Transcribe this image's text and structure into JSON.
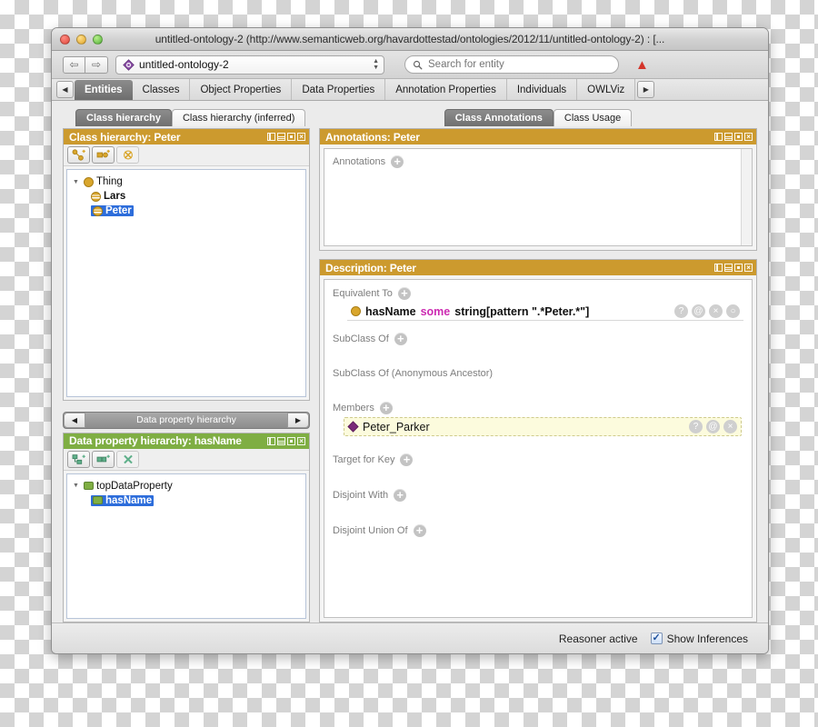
{
  "window": {
    "title": "untitled-ontology-2 (http://www.semanticweb.org/havardottestad/ontologies/2012/11/untitled-ontology-2)  : [...",
    "traffic": {
      "close": "close-button",
      "minimize": "minimize-button",
      "zoom": "zoom-button"
    }
  },
  "toolbar": {
    "back_icon": "⇦",
    "forward_icon": "⇨",
    "ontology_label": "untitled-ontology-2",
    "search_placeholder": "Search for entity",
    "search_value": "",
    "warning_icon": "⚠"
  },
  "main_tabs": {
    "prev_arrow": "◀",
    "next_arrow": "▶",
    "items": [
      {
        "label": "Entities",
        "active": true
      },
      {
        "label": "Classes",
        "active": false
      },
      {
        "label": "Object Properties",
        "active": false
      },
      {
        "label": "Data Properties",
        "active": false
      },
      {
        "label": "Annotation Properties",
        "active": false
      },
      {
        "label": "Individuals",
        "active": false
      },
      {
        "label": "OWLViz",
        "active": false
      }
    ]
  },
  "class_hierarchy": {
    "tabs": [
      {
        "label": "Class hierarchy",
        "active": true
      },
      {
        "label": "Class hierarchy (inferred)",
        "active": false
      }
    ],
    "header": "Class hierarchy: Peter",
    "buttons": [
      {
        "name": "add-subclass-button"
      },
      {
        "name": "add-sibling-class-button"
      },
      {
        "name": "delete-class-button"
      }
    ],
    "tree": [
      {
        "label": "Thing",
        "indent": 0,
        "expander": "▼",
        "selected": false,
        "icon": "class-icon"
      },
      {
        "label": "Lars",
        "indent": 1,
        "expander": "",
        "selected": false,
        "icon": "class-defined-icon"
      },
      {
        "label": "Peter",
        "indent": 1,
        "expander": "",
        "selected": true,
        "icon": "class-defined-icon"
      }
    ]
  },
  "data_property_hierarchy": {
    "selector": {
      "left_arrow": "◀",
      "title": "Data property hierarchy",
      "right_arrow": "▶"
    },
    "header": "Data property hierarchy: hasName",
    "buttons": [
      {
        "name": "add-sub-property-button"
      },
      {
        "name": "add-sibling-property-button"
      },
      {
        "name": "delete-property-button"
      }
    ],
    "tree": [
      {
        "label": "topDataProperty",
        "indent": 0,
        "expander": "▼",
        "selected": false
      },
      {
        "label": "hasName",
        "indent": 1,
        "expander": "",
        "selected": true
      }
    ]
  },
  "annotations_panel": {
    "tabs": [
      {
        "label": "Class Annotations",
        "active": true
      },
      {
        "label": "Class Usage",
        "active": false
      }
    ],
    "header": "Annotations: Peter",
    "section_label": "Annotations"
  },
  "description_panel": {
    "header": "Description: Peter",
    "sections": [
      {
        "label": "Equivalent To",
        "has_add": true,
        "rows": [
          {
            "icon": "class-icon",
            "prefix": "hasName ",
            "keyword": "some",
            "suffix": " string[pattern \".*Peter.*\"]",
            "buttons": [
              "?",
              "@",
              "×",
              "○"
            ],
            "highlight": false
          }
        ]
      },
      {
        "label": "SubClass Of",
        "has_add": true,
        "rows": []
      },
      {
        "label": "SubClass Of (Anonymous Ancestor)",
        "has_add": false,
        "rows": []
      },
      {
        "label": "Members",
        "has_add": true,
        "rows": [
          {
            "icon": "individual-icon",
            "prefix": "Peter_Parker",
            "keyword": "",
            "suffix": "",
            "buttons": [
              "?",
              "@",
              "×"
            ],
            "highlight": true
          }
        ]
      },
      {
        "label": "Target for Key",
        "has_add": true,
        "rows": []
      },
      {
        "label": "Disjoint With",
        "has_add": true,
        "rows": []
      },
      {
        "label": "Disjoint Union Of",
        "has_add": true,
        "rows": []
      }
    ]
  },
  "status_bar": {
    "reasoner_text": "Reasoner active",
    "show_inferences_label": "Show Inferences",
    "show_inferences_checked": true,
    "check_glyph": "✓"
  },
  "colors": {
    "gold_header": "#cc9a2e",
    "green_header": "#7fae43",
    "selection_blue": "#2d6ddb",
    "keyword_magenta": "#cc2bb1",
    "individual_purple": "#7a2a78",
    "highlight_yellow": "#fcfbdd"
  }
}
